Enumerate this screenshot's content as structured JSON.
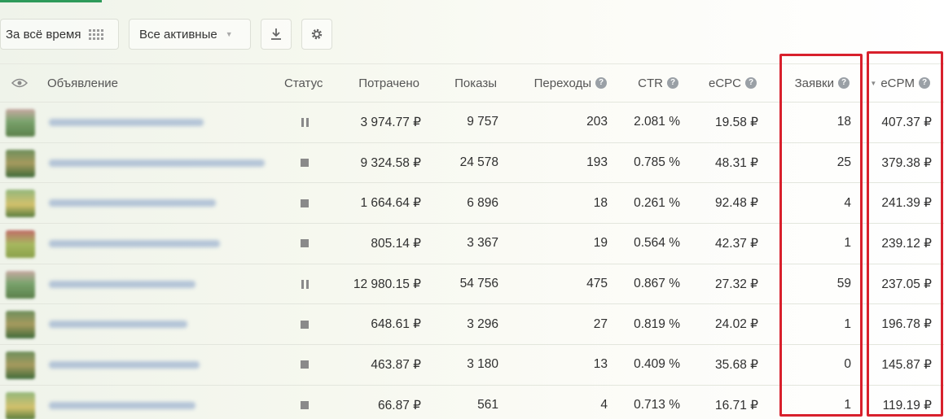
{
  "toolbar": {
    "period_label": "За всё время",
    "filter_label": "Все активные",
    "download_icon": "download-icon",
    "settings_icon": "gear-icon"
  },
  "table": {
    "headers": {
      "visibility": "eye-icon",
      "ad": "Объявление",
      "status": "Статус",
      "spent": "Потрачено",
      "impressions": "Показы",
      "clicks": "Переходы",
      "ctr": "CTR",
      "ecpc": "eCPC",
      "leads": "Заявки",
      "ecpm": "eCPM"
    },
    "help_glyph": "?",
    "sort_glyph": "▼",
    "rows": [
      {
        "status": "paused",
        "spent": "3 974.77 ₽",
        "impressions": "9 757",
        "clicks": "203",
        "ctr": "2.081 %",
        "ecpc": "19.58 ₽",
        "leads": "18",
        "ecpm": "407.37 ₽"
      },
      {
        "status": "stopped",
        "spent": "9 324.58 ₽",
        "impressions": "24 578",
        "clicks": "193",
        "ctr": "0.785 %",
        "ecpc": "48.31 ₽",
        "leads": "25",
        "ecpm": "379.38 ₽"
      },
      {
        "status": "stopped",
        "spent": "1 664.64 ₽",
        "impressions": "6 896",
        "clicks": "18",
        "ctr": "0.261 %",
        "ecpc": "92.48 ₽",
        "leads": "4",
        "ecpm": "241.39 ₽"
      },
      {
        "status": "stopped",
        "spent": "805.14 ₽",
        "impressions": "3 367",
        "clicks": "19",
        "ctr": "0.564 %",
        "ecpc": "42.37 ₽",
        "leads": "1",
        "ecpm": "239.12 ₽"
      },
      {
        "status": "paused",
        "spent": "12 980.15 ₽",
        "impressions": "54 756",
        "clicks": "475",
        "ctr": "0.867 %",
        "ecpc": "27.32 ₽",
        "leads": "59",
        "ecpm": "237.05 ₽"
      },
      {
        "status": "stopped",
        "spent": "648.61 ₽",
        "impressions": "3 296",
        "clicks": "27",
        "ctr": "0.819 %",
        "ecpc": "24.02 ₽",
        "leads": "1",
        "ecpm": "196.78 ₽"
      },
      {
        "status": "stopped",
        "spent": "463.87 ₽",
        "impressions": "3 180",
        "clicks": "13",
        "ctr": "0.409 %",
        "ecpc": "35.68 ₽",
        "leads": "0",
        "ecpm": "145.87 ₽"
      },
      {
        "status": "stopped",
        "spent": "66.87 ₽",
        "impressions": "561",
        "clicks": "4",
        "ctr": "0.713 %",
        "ecpc": "16.71 ₽",
        "leads": "1",
        "ecpm": "119.19 ₽"
      }
    ]
  },
  "colors": {
    "highlight": "#d8202c",
    "accent": "#2e9a5a"
  }
}
